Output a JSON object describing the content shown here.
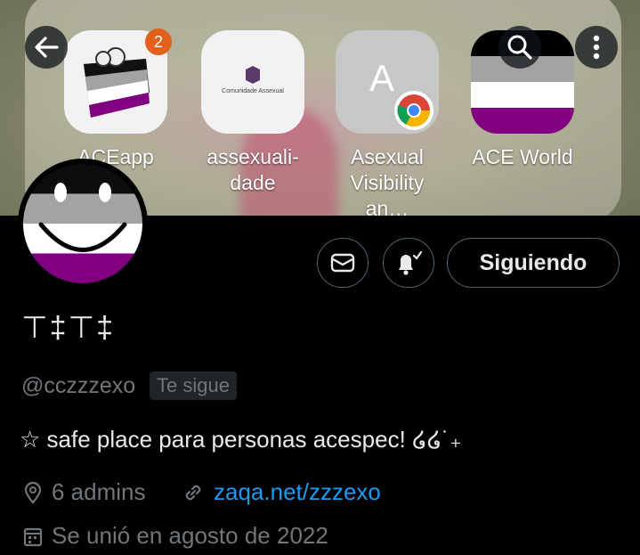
{
  "banner": {
    "apps": [
      {
        "label": "ACEapp",
        "badge": "2",
        "icon": "cake-icon"
      },
      {
        "label": "assexuali-\ndade",
        "tile_text": "Comunidade Assexual",
        "icon": "comunidade-icon"
      },
      {
        "label": "Asexual\nVisibility an…",
        "tile_letter": "A",
        "icon": "chrome-icon"
      },
      {
        "label": "ACE World",
        "icon": "ace-flag-icon"
      }
    ]
  },
  "profile": {
    "name": "⊤‡⊤‡",
    "handle": "@cczzzexo",
    "follows_you": "Te sigue",
    "bio": "☆ safe place para personas acespec! ໒໒˙₊",
    "location": "6 admins",
    "website": "zaqa.net/zzzexo",
    "joined": "Se unió en agosto de 2022"
  },
  "actions": {
    "following_label": "Siguiendo"
  },
  "colors": {
    "accent": "#1d9bf0",
    "muted": "#71767b",
    "ace_purple": "#800080",
    "ace_gray": "#a3a3a3"
  }
}
